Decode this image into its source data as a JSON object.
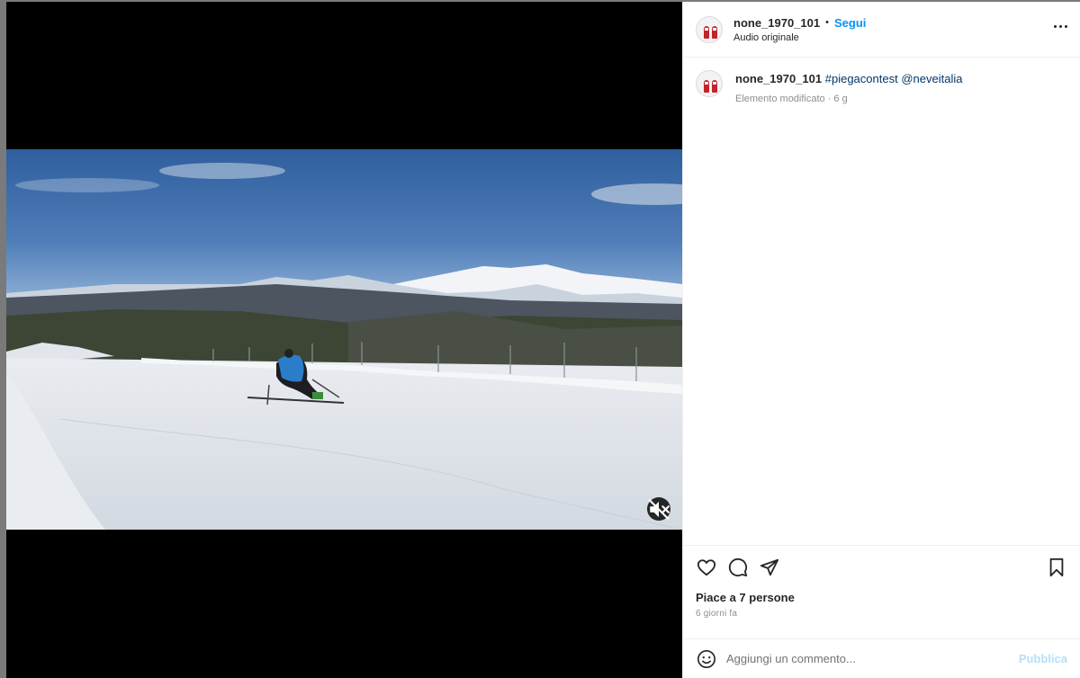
{
  "post": {
    "username": "none_1970_101",
    "follow_label": "Segui",
    "separator": "•",
    "audio_label": "Audio originale"
  },
  "caption": {
    "username": "none_1970_101",
    "hashtag": "#piegacontest",
    "mention": "@neveitalia",
    "meta": "Elemento modificato · 6 g"
  },
  "engagement": {
    "likes_text": "Piace a 7 persone",
    "time_text": "6 giorni fa"
  },
  "comment": {
    "placeholder": "Aggiungi un commento...",
    "publish_label": "Pubblica"
  },
  "icons": {
    "more": "more-options-icon",
    "mute": "muted-speaker-icon",
    "like": "heart-icon",
    "comment": "comment-bubble-icon",
    "share": "paper-plane-icon",
    "save": "bookmark-icon",
    "emoji": "smiley-icon"
  },
  "colors": {
    "accent": "#0095f6",
    "link": "#00376b",
    "publish_disabled": "#b2dffc",
    "secondary_text": "#8e8e8e"
  }
}
